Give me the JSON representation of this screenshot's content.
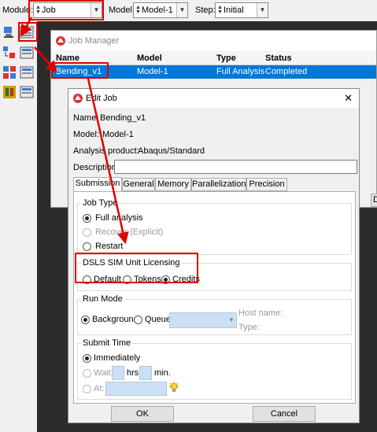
{
  "topbar": {
    "module_label": "Module:",
    "module_value": "Job",
    "model_label": "Model:",
    "model_value": "Model-1",
    "step_label": "Step:",
    "step_value": "Initial"
  },
  "job_manager": {
    "title": "Job Manager",
    "columns": [
      "Name",
      "Model",
      "Type",
      "Status"
    ],
    "rows": [
      {
        "name": "Bending_v1",
        "model": "Model-1",
        "type": "Full Analysis",
        "status": "Completed"
      }
    ],
    "right_button_fragment": "D"
  },
  "edit_job": {
    "title": "Edit Job",
    "name_label": "Name:",
    "name_value": "Bending_v1",
    "model_label": "Model:",
    "model_value": "Model-1",
    "product_label": "Analysis product:",
    "product_value": "Abaqus/Standard",
    "description_label": "Description:",
    "description_value": "",
    "tabs": [
      "Submission",
      "General",
      "Memory",
      "Parallelization",
      "Precision"
    ],
    "active_tab": "Submission",
    "job_type": {
      "label": "Job Type",
      "options": [
        "Full analysis",
        "Recover (Explicit)",
        "Restart"
      ],
      "selected": "Full analysis"
    },
    "licensing": {
      "label": "DSLS SIM Unit Licensing",
      "options": [
        "Default",
        "Tokens",
        "Credits"
      ],
      "selected": "Credits"
    },
    "run_mode": {
      "label": "Run Mode",
      "background": "Background",
      "queue": "Queue:",
      "host_name": "Host name:",
      "type": "Type:",
      "selected": "Background"
    },
    "submit_time": {
      "label": "Submit Time",
      "immediately": "Immediately",
      "wait": "Wait:",
      "hrs": "hrs.",
      "min": "min.",
      "at": "At:",
      "selected": "Immediately"
    },
    "ok_label": "OK",
    "cancel_label": "Cancel",
    "close_glyph": "✕"
  },
  "colors": {
    "selection": "#0078d7",
    "highlight": "#e00000",
    "background_dark": "#2b2b2b"
  }
}
